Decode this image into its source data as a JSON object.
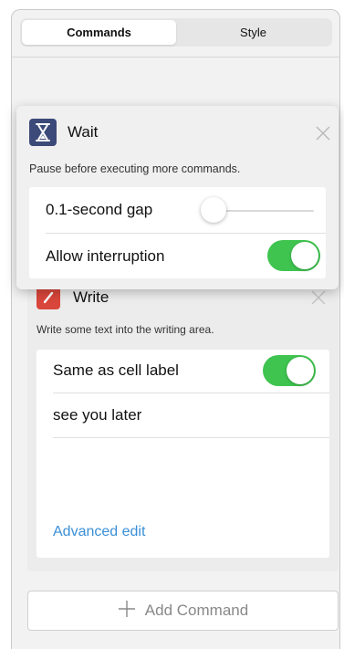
{
  "tabs": [
    {
      "label": "Commands",
      "active": true
    },
    {
      "label": "Style",
      "active": false
    }
  ],
  "wait_card": {
    "icon": "hourglass-icon",
    "icon_color": "#3b4a78",
    "title": "Wait",
    "description": "Pause before executing more commands.",
    "gap_label": "0.1-second gap",
    "gap_slider_value": 0.02,
    "interrupt_label": "Allow interruption",
    "interrupt_on": true
  },
  "write_card": {
    "icon": "pencil-icon",
    "icon_color": "#d9463b",
    "title": "Write",
    "description": "Write some text into the writing area.",
    "same_label": "Same as cell label",
    "same_on": true,
    "text_value": "see you later",
    "advanced_label": "Advanced edit"
  },
  "add_command": {
    "label": "Add Command",
    "icon": "plus-icon"
  },
  "colors": {
    "toggle_on": "#3ec44f",
    "link": "#3a8fd6",
    "slider_fill": "#3a8fd6"
  }
}
